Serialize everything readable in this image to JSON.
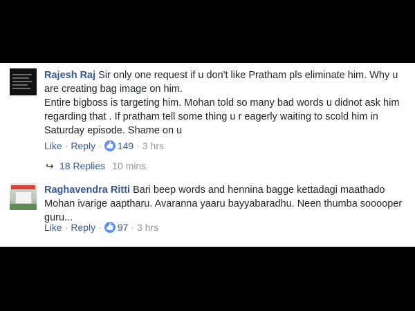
{
  "comments": [
    {
      "author": "Rajesh Raj",
      "lines": [
        "Sir only one request if u don't like Pratham pls eliminate him. Why u",
        "are creating bag image on him.",
        "Entire bigboss is targeting him. Mohan told so many bad words u didnot ask him",
        "regarding that . If pratham tell some thing u r eagerly waiting to scold him in",
        "Saturday episode. Shame on u"
      ],
      "like_label": "Like",
      "reply_label": "Reply",
      "reactions": "149",
      "time": "3 hrs",
      "replies": {
        "label": "18 Replies",
        "time": "10 mins"
      }
    },
    {
      "author": "Raghavendra Ritti",
      "lines": [
        "Bari beep words and hennina bagge kettadagi maathado",
        "Mohan ivarige aaptharu. Avaranna yaaru bayyabaradhu. Neen thumba sooooper",
        "guru..."
      ],
      "like_label": "Like",
      "reply_label": "Reply",
      "reactions": "97",
      "time": "3 hrs"
    }
  ],
  "icons": {
    "like": "thumbs-up-icon",
    "reply_arrow": "reply-arrow-icon"
  },
  "colors": {
    "link": "#365899",
    "text": "#1d2129",
    "meta": "#90949c",
    "like_badge": "#5890ff"
  }
}
